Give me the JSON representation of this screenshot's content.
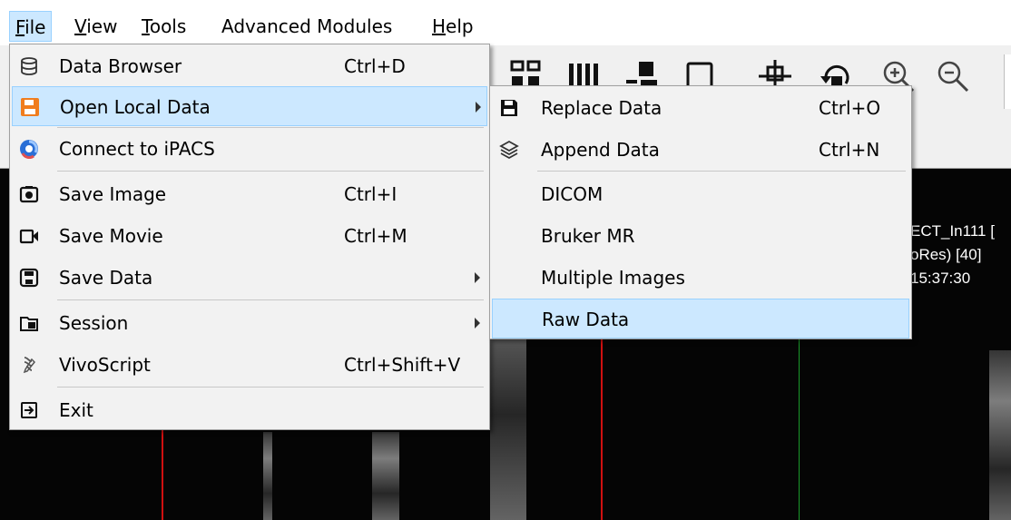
{
  "menubar": {
    "items": [
      {
        "underline": "F",
        "rest": "ile"
      },
      {
        "underline": "V",
        "rest": "iew"
      },
      {
        "underline": "T",
        "rest": "ools"
      },
      {
        "label": "Advanced Modules"
      },
      {
        "underline": "H",
        "rest": "elp"
      }
    ]
  },
  "file_menu": {
    "items": [
      {
        "label": "Data Browser",
        "shortcut": "Ctrl+D",
        "icon": "database-icon"
      },
      {
        "label": "Open Local Data",
        "shortcut": "",
        "icon": "folder-open-icon",
        "submenu": true
      },
      {
        "label": "Connect to iPACS",
        "shortcut": "",
        "icon": "ipacs-icon"
      },
      {
        "label": "Save Image",
        "shortcut": "Ctrl+I",
        "icon": "camera-icon"
      },
      {
        "label": "Save Movie",
        "shortcut": "Ctrl+M",
        "icon": "video-camera-icon"
      },
      {
        "label": "Save Data",
        "shortcut": "",
        "icon": "save-icon",
        "submenu": true
      },
      {
        "label": "Session",
        "shortcut": "",
        "icon": "session-folder-icon",
        "submenu": true
      },
      {
        "label": "VivoScript",
        "shortcut": "Ctrl+Shift+V",
        "icon": "script-icon"
      },
      {
        "label": "Exit",
        "shortcut": "",
        "icon": "exit-icon"
      }
    ]
  },
  "open_local_submenu": {
    "items": [
      {
        "label": "Replace Data",
        "shortcut": "Ctrl+O",
        "icon": "floppy-disk-icon"
      },
      {
        "label": "Append Data",
        "shortcut": "Ctrl+N",
        "icon": "layers-icon"
      },
      {
        "label": "DICOM",
        "shortcut": ""
      },
      {
        "label": "Bruker MR",
        "shortcut": ""
      },
      {
        "label": "Multiple Images",
        "shortcut": ""
      },
      {
        "label": "Raw Data",
        "shortcut": ""
      }
    ]
  },
  "viewer": {
    "overlay_lines": [
      "ECT_In111 [",
      "oRes) [40]",
      "15:37:30"
    ]
  },
  "colors": {
    "highlight": "#cce8ff",
    "highlight_border": "#99d1ff",
    "red_crosshair": "#d01010",
    "green_crosshair": "#1a9a2a",
    "accent_orange": "#f07d1e"
  }
}
